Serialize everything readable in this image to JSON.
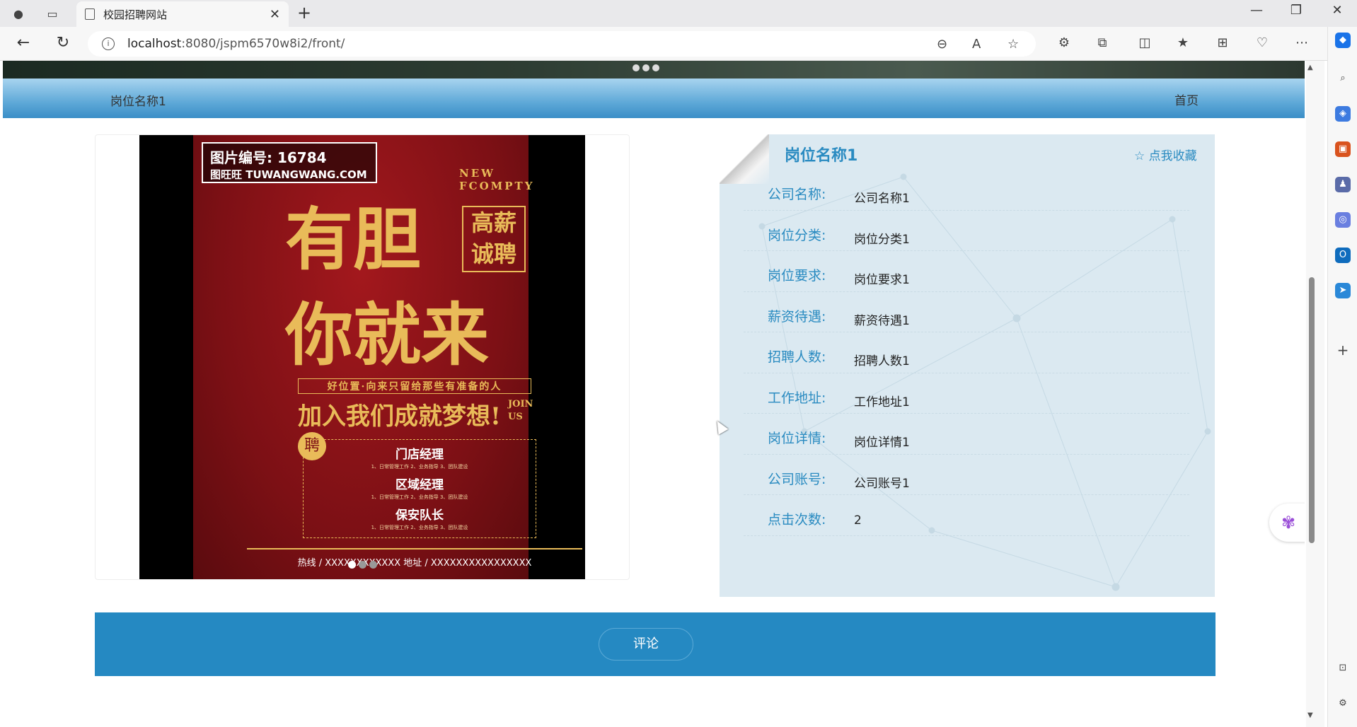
{
  "browser": {
    "tab_title": "校园招聘网站",
    "url_host": "localhost",
    "url_path": ":8080/jspm6570w8i2/front/"
  },
  "nav": {
    "crumb": "岗位名称1",
    "home": "首页"
  },
  "poster": {
    "stamp_line1": "图片编号:   16784",
    "stamp_line2": "图旺旺 TUWANGWANG.COM",
    "new_text": "NEW FCOMPTY",
    "big1": "有胆",
    "big2": "你就来",
    "box_text": "高薪诚聘",
    "slogan": "好位置·向来只留给那些有准备的人",
    "join": "加入我们成就梦想!",
    "joinus": "JOIN US",
    "hire_char": "聘",
    "jobs": [
      "门店经理",
      "区域经理",
      "保安队长"
    ],
    "job_desc": "1、日常管理工作 2、业务指导 3、团队建设",
    "footer": "热线 / XXXXXXXXXXXX  地址 / XXXXXXXXXXXXXXXX"
  },
  "job": {
    "title": "岗位名称1",
    "favorite": "☆ 点我收藏",
    "fields": [
      {
        "label": "公司名称:",
        "value": "公司名称1"
      },
      {
        "label": "岗位分类:",
        "value": "岗位分类1"
      },
      {
        "label": "岗位要求:",
        "value": "岗位要求1"
      },
      {
        "label": "薪资待遇:",
        "value": "薪资待遇1"
      },
      {
        "label": "招聘人数:",
        "value": "招聘人数1"
      },
      {
        "label": "工作地址:",
        "value": "工作地址1"
      },
      {
        "label": "岗位详情:",
        "value": "岗位详情1"
      },
      {
        "label": "公司账号:",
        "value": "公司账号1"
      },
      {
        "label": "点击次数:",
        "value": "2"
      }
    ]
  },
  "comment_button": "评论",
  "colors": {
    "accent": "#2589c2",
    "label": "#2a8bc1",
    "panel_bg": "#dbe9f1",
    "poster_red": "#7d1015",
    "poster_gold": "#e9bb59"
  }
}
